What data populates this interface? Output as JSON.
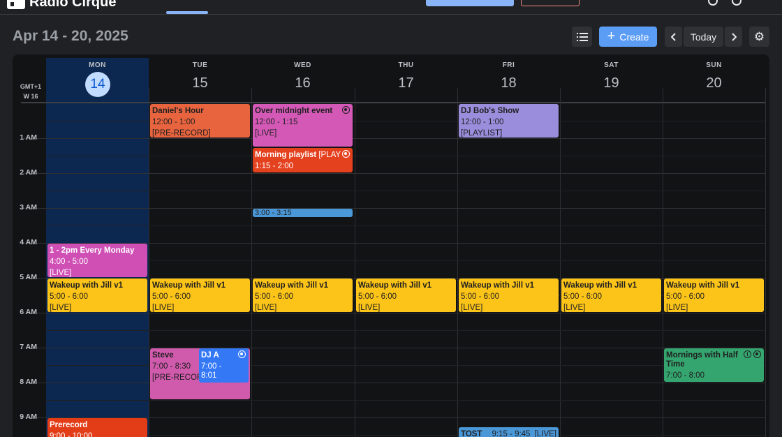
{
  "app": {
    "name": "Radio Cirque"
  },
  "toolbar": {
    "date_range": "Apr 14 - 20, 2025",
    "create_label": "Create",
    "today_label": "Today",
    "prev_icon": "chevron-left-icon",
    "next_icon": "chevron-right-icon",
    "list_icon": "list-icon",
    "settings_icon": "gear-icon"
  },
  "calendar": {
    "timezone": "GMT+1",
    "week": "W 16",
    "days": [
      {
        "name": "MON",
        "num": "14",
        "today": true
      },
      {
        "name": "TUE",
        "num": "15"
      },
      {
        "name": "WED",
        "num": "16"
      },
      {
        "name": "THU",
        "num": "17"
      },
      {
        "name": "FRI",
        "num": "18"
      },
      {
        "name": "SAT",
        "num": "19"
      },
      {
        "name": "SUN",
        "num": "20"
      }
    ],
    "hours": [
      "1 AM",
      "2 AM",
      "3 AM",
      "4 AM",
      "5 AM",
      "6 AM",
      "7 AM",
      "8 AM",
      "9 AM"
    ],
    "events": [
      {
        "day": 1,
        "title": "Daniel's Hour",
        "time": "12:00 - 1:00",
        "tag": "[PRE-RECORD]",
        "color": "#e8643f",
        "start": 0,
        "end": 1
      },
      {
        "day": 2,
        "title": "Over midnight event",
        "time": "12:00 - 1:15",
        "tag": "[LIVE]",
        "color": "#d459b7",
        "start": 0,
        "end": 1.25,
        "icon": "record-icon"
      },
      {
        "day": 2,
        "title": "Morning playlist",
        "inline_tag": "[PLAY",
        "time": "1:15 - 2:00",
        "color": "#e4411f",
        "light": true,
        "start": 1.25,
        "end": 2,
        "icon": "record-icon"
      },
      {
        "day": 2,
        "title": "",
        "time": "3:00 - 3:15",
        "color": "#4a98d8",
        "start": 3,
        "end": 3.25
      },
      {
        "day": 4,
        "title": "DJ Bob's Show",
        "time": "12:00 - 1:00",
        "tag": "[PLAYLIST]",
        "color": "#9a8ddc",
        "start": 0,
        "end": 1
      },
      {
        "day": 0,
        "title": "1 - 2pm Every Monday",
        "time": "4:00 - 5:00",
        "tag": "[LIVE]",
        "color": "#cf4fb5",
        "light": true,
        "start": 4,
        "end": 5
      },
      {
        "day": 0,
        "title": "Wakeup with Jill v1",
        "time": "5:00 - 6:00",
        "tag": "[LIVE]",
        "color": "#fcc419",
        "start": 5,
        "end": 6
      },
      {
        "day": 1,
        "title": "Wakeup with Jill v1",
        "time": "5:00 - 6:00",
        "tag": "[LIVE]",
        "color": "#fcc419",
        "start": 5,
        "end": 6
      },
      {
        "day": 2,
        "title": "Wakeup with Jill v1",
        "time": "5:00 - 6:00",
        "tag": "[LIVE]",
        "color": "#fcc419",
        "start": 5,
        "end": 6
      },
      {
        "day": 3,
        "title": "Wakeup with Jill v1",
        "time": "5:00 - 6:00",
        "tag": "[LIVE]",
        "color": "#fcc419",
        "start": 5,
        "end": 6
      },
      {
        "day": 4,
        "title": "Wakeup with Jill v1",
        "time": "5:00 - 6:00",
        "tag": "[LIVE]",
        "color": "#fcc419",
        "start": 5,
        "end": 6
      },
      {
        "day": 5,
        "title": "Wakeup with Jill v1",
        "time": "5:00 - 6:00",
        "tag": "[LIVE]",
        "color": "#fcc419",
        "start": 5,
        "end": 6
      },
      {
        "day": 6,
        "title": "Wakeup with Jill v1",
        "time": "5:00 - 6:00",
        "tag": "[LIVE]",
        "color": "#fcc419",
        "start": 5,
        "end": 6
      },
      {
        "day": 1,
        "title": "Steve",
        "time": "7:00 - 8:30",
        "tag": "[PRE-RECORD]",
        "color": "#d05aac",
        "start": 7,
        "end": 8.5
      },
      {
        "day": 1,
        "title": "DJ A",
        "time": "7:00 -",
        "time2": "8:01",
        "color": "#3478f6",
        "light": true,
        "start": 7,
        "end": 8.02,
        "half": "right",
        "icon": "record-icon"
      },
      {
        "day": 6,
        "title": "Mornings with Half",
        "title2": "Time",
        "time": "7:00 - 8:00",
        "color": "#34a56f",
        "start": 7,
        "end": 8,
        "icon": "record-icon",
        "icon2": "info-icon"
      },
      {
        "day": 0,
        "title": "Prerecord",
        "time": "9:00 - 10:00",
        "color": "#e33d18",
        "light": true,
        "start": 9,
        "end": 10
      },
      {
        "day": 4,
        "title": "TOST",
        "time": "9:15 - 9:45",
        "tag": "[LIVE]",
        "color": "#4a98d8",
        "start": 9.25,
        "end": 9.75,
        "inline": true
      }
    ]
  }
}
